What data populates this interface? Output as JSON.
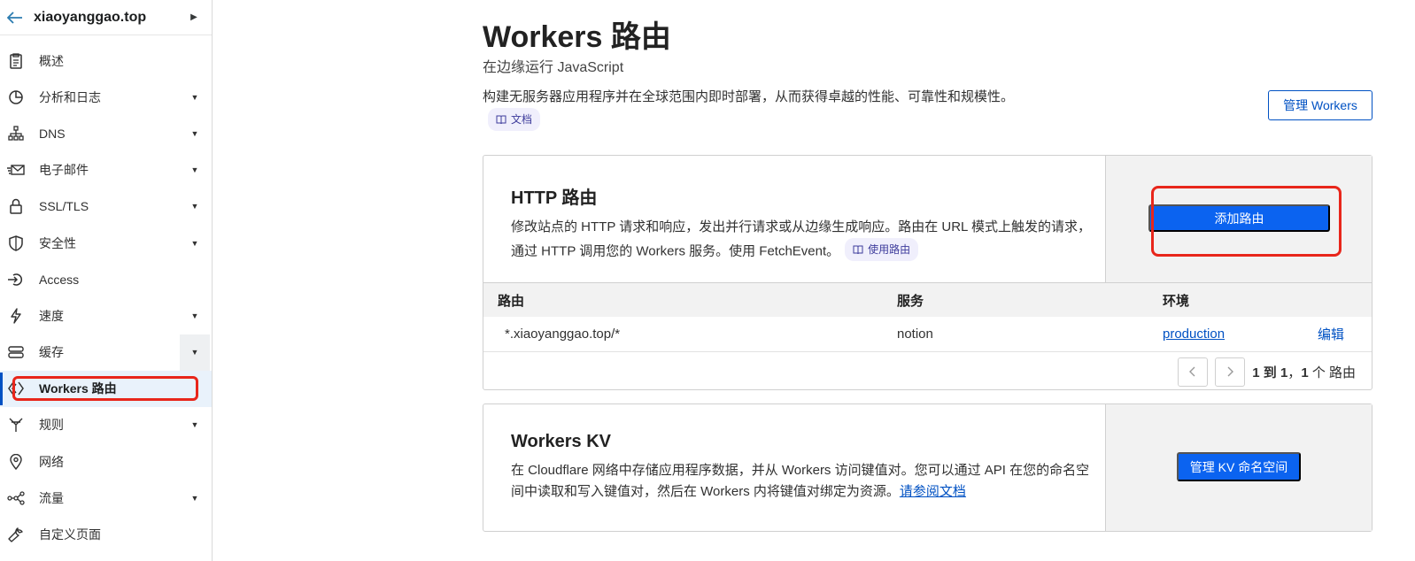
{
  "sidebar": {
    "site_name": "xiaoyanggao.top",
    "items": [
      {
        "label": "概述",
        "icon": "document-icon",
        "has_caret": false
      },
      {
        "label": "分析和日志",
        "icon": "pie-chart-icon",
        "has_caret": true
      },
      {
        "label": "DNS",
        "icon": "network-icon",
        "has_caret": true
      },
      {
        "label": "电子邮件",
        "icon": "email-icon",
        "has_caret": true
      },
      {
        "label": "SSL/TLS",
        "icon": "lock-icon",
        "has_caret": true
      },
      {
        "label": "安全性",
        "icon": "shield-icon",
        "has_caret": true
      },
      {
        "label": "Access",
        "icon": "access-icon",
        "has_caret": false
      },
      {
        "label": "速度",
        "icon": "lightning-icon",
        "has_caret": true
      },
      {
        "label": "缓存",
        "icon": "storage-icon",
        "has_caret": true
      },
      {
        "label": "Workers 路由",
        "icon": "workers-icon",
        "has_caret": false,
        "active": true
      },
      {
        "label": "规则",
        "icon": "rules-icon",
        "has_caret": true
      },
      {
        "label": "网络",
        "icon": "location-icon",
        "has_caret": false
      },
      {
        "label": "流量",
        "icon": "traffic-icon",
        "has_caret": true
      },
      {
        "label": "自定义页面",
        "icon": "wrench-icon",
        "has_caret": false
      }
    ]
  },
  "header": {
    "title": "Workers 路由",
    "subtitle": "在边缘运行 JavaScript",
    "description": "构建无服务器应用程序并在全球范围内即时部署，从而获得卓越的性能、可靠性和规模性。",
    "doc_pill": "文档",
    "manage_workers_label": "管理 Workers"
  },
  "http_card": {
    "title": "HTTP 路由",
    "description": "修改站点的 HTTP 请求和响应，发出并行请求或从边缘生成响应。路由在 URL 模式上触发的请求，通过 HTTP 调用您的 Workers 服务。使用 FetchEvent。",
    "pill": "使用路由",
    "add_route_label": "添加路由",
    "table": {
      "headers": [
        "路由",
        "服务",
        "环境"
      ],
      "rows": [
        {
          "route": "*.xiaoyanggao.top/*",
          "service": "notion",
          "environment": "production",
          "action": "编辑"
        }
      ],
      "pagination": {
        "range_start": "1",
        "to_word": "到",
        "range_end": "1",
        "total": "1",
        "unit": "个 路由"
      }
    }
  },
  "kv_card": {
    "title": "Workers KV",
    "description": "在 Cloudflare 网络中存储应用程序数据，并从 Workers 访问键值对。您可以通过 API 在您的命名空间中读取和写入键值对，然后在 Workers 内将键值对绑定为资源。",
    "link_text": "请参阅文档",
    "button_label": "管理 KV 命名空间"
  },
  "colors": {
    "accent": "#0051c3",
    "primary_button": "#0b63f0",
    "highlight": "#e8261b"
  }
}
